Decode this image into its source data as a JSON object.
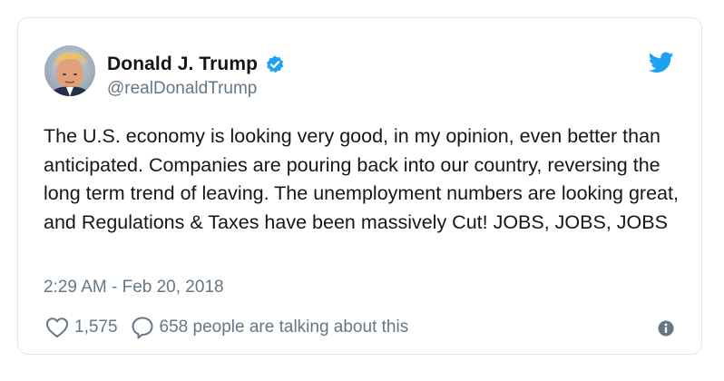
{
  "author": {
    "display_name": "Donald J. Trump",
    "handle": "@realDonaldTrump",
    "verified": true,
    "avatar_icon": "profile-photo"
  },
  "tweet": {
    "text": "The U.S. economy is looking very good, in my opinion, even better than anticipated. Companies are pouring back into our country, reversing the long term trend of leaving. The unemployment numbers are looking great, and Regulations & Taxes have been massively Cut! JOBS, JOBS, JOBS",
    "timestamp": "2:29 AM - Feb 20, 2018"
  },
  "engagement": {
    "likes": "1,575",
    "talking": "658 people are talking about this"
  },
  "icons": {
    "brand": "twitter-bird-icon",
    "like": "heart-icon",
    "reply": "speech-bubble-icon",
    "info": "info-icon",
    "verified": "verified-badge-icon"
  },
  "colors": {
    "brand_blue": "#1da1f2",
    "text_primary": "#14171a",
    "text_secondary": "#657786",
    "border": "#e1e8ed"
  }
}
